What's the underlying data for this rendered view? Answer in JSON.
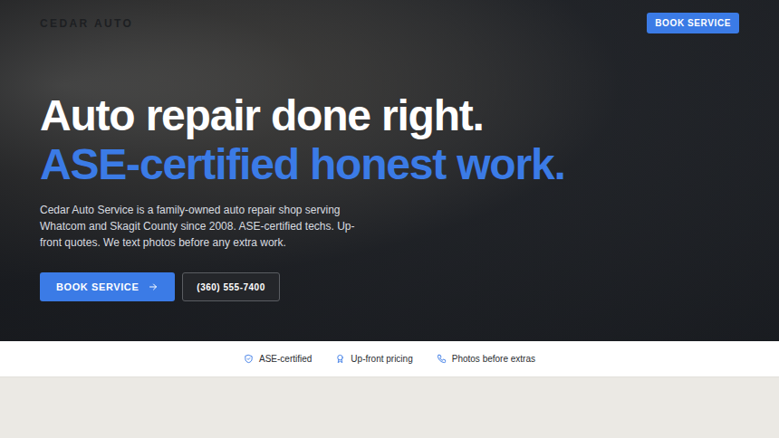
{
  "nav": {
    "logo": "CEDAR AUTO",
    "cta": "BOOK SERVICE"
  },
  "hero": {
    "title": "Auto repair done right.",
    "subtitle": "ASE-certified honest work.",
    "body": "Cedar Auto Service is a family-owned auto repair shop serving Whatcom and Skagit County since 2008. ASE-certified techs. Up-front quotes. We text photos before any extra work.",
    "primary_button": "BOOK SERVICE",
    "phone_button": "(360) 555-7400"
  },
  "trust_bar": [
    {
      "label": "ASE-certified",
      "kind": "shield"
    },
    {
      "label": "Up-front pricing",
      "kind": "award"
    },
    {
      "label": "Photos before extras",
      "kind": "phone"
    }
  ]
}
